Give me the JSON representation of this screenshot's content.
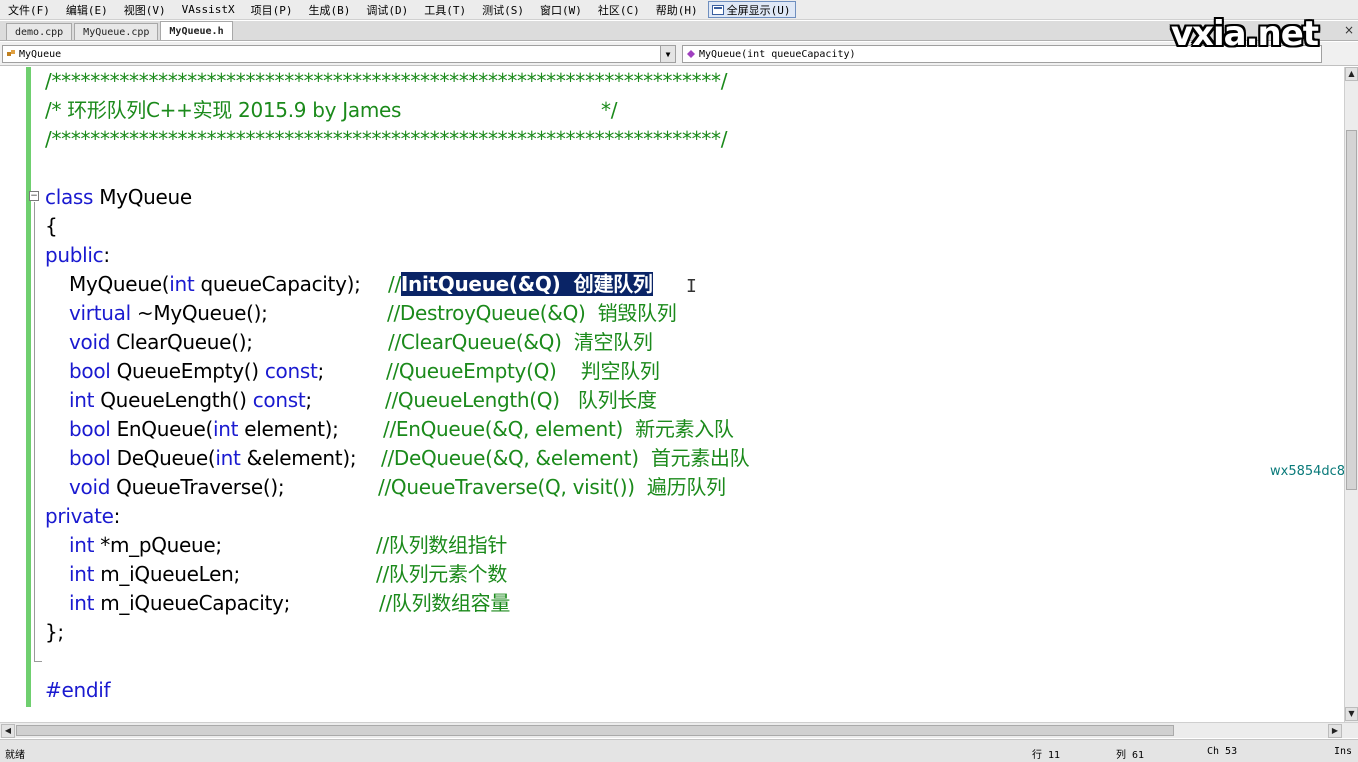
{
  "menu": [
    "文件(F)",
    "编辑(E)",
    "视图(V)",
    "VAssistX",
    "项目(P)",
    "生成(B)",
    "调试(D)",
    "工具(T)",
    "测试(S)",
    "窗口(W)",
    "社区(C)",
    "帮助(H)"
  ],
  "fullscreen_label": "全屏显示(U)",
  "tabs": [
    {
      "label": "demo.cpp"
    },
    {
      "label": "MyQueue.cpp"
    },
    {
      "label": "MyQueue.h",
      "active": true
    }
  ],
  "tab_close": "×",
  "nav": {
    "scope": "MyQueue",
    "member": "MyQueue(int queueCapacity)",
    "dropdown_glyph": "▼"
  },
  "watermark": "vxia.net",
  "editor": {
    "comment_border": "/*********************************************************************/",
    "comment_text": "/* 环形队列C++实现 2015.9 by James                                 */",
    "class_kw": "class",
    "class_name": " MyQueue",
    "open_brace": "{",
    "public_kw": "public",
    "colon": ":",
    "private_kw": "private",
    "close_brace": "};",
    "endif": "#endif",
    "methods": [
      {
        "pre": "MyQueue(",
        "kw": "int",
        "post": " queueCapacity);   ",
        "comment_pre": "//",
        "comment_sel": "InitQueue(&Q)  创建队列"
      },
      {
        "kw": "virtual",
        "post": " ~MyQueue();",
        "comment": "//DestroyQueue(&Q)  销毁队列"
      },
      {
        "kw": "void",
        "post": " ClearQueue();",
        "comment": "//ClearQueue(&Q)  清空队列"
      },
      {
        "kw": "bool",
        "post": " QueueEmpty() ",
        "kw2": "const",
        "post2": ";",
        "comment": "//QueueEmpty(Q)    判空队列"
      },
      {
        "kw": "int",
        "post": " QueueLength() ",
        "kw2": "const",
        "post2": ";",
        "comment": "//QueueLength(Q)   队列长度"
      },
      {
        "kw": "bool",
        "post": " EnQueue(",
        "kw2": "int",
        "post2": " element);",
        "comment": "//EnQueue(&Q, element)  新元素入队"
      },
      {
        "kw": "bool",
        "post": " DeQueue(",
        "kw2": "int",
        "post2": " &element);",
        "comment": "//DeQueue(&Q, &element)  首元素出队"
      },
      {
        "kw": "void",
        "post": " QueueTraverse();",
        "comment": "//QueueTraverse(Q, visit())  遍历队列"
      }
    ],
    "members": [
      {
        "kw": "int",
        "post": " *m_pQueue;",
        "comment": "//队列数组指针"
      },
      {
        "kw": "int",
        "post": " m_iQueueLen;",
        "comment": "//队列元素个数"
      },
      {
        "kw": "int",
        "post": " m_iQueueCapacity;",
        "comment": "//队列数组容量"
      }
    ]
  },
  "side_id": "wx5854dc86d",
  "status": {
    "ready": "就绪",
    "line": "行 11",
    "col": "列 61",
    "ch": "Ch 53",
    "mode": "Ins"
  },
  "colors": {
    "keyword": "#1a1ad0",
    "comment": "#1b8a1b",
    "selection": "#0a2466",
    "margin": "#6fcf6f"
  }
}
